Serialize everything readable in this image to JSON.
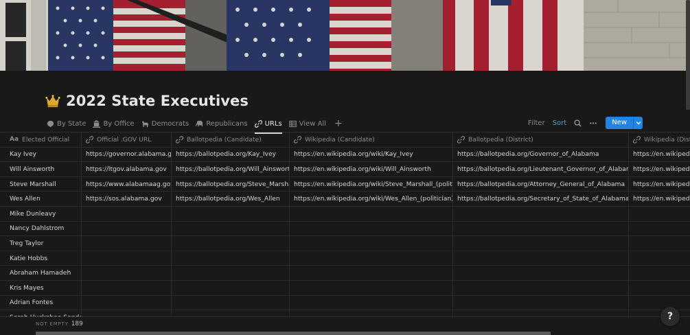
{
  "page": {
    "title": "2022 State Executives",
    "icon": "crown-icon"
  },
  "views": [
    {
      "label": "By State",
      "icon": "brain-icon"
    },
    {
      "label": "By Office",
      "icon": "building-icon"
    },
    {
      "label": "Democrats",
      "icon": "donkey-icon"
    },
    {
      "label": "Republicans",
      "icon": "elephant-icon"
    },
    {
      "label": "URLs",
      "icon": "link-icon",
      "active": true
    },
    {
      "label": "View All",
      "icon": "table-icon"
    }
  ],
  "toolbar": {
    "filter": "Filter",
    "sort": "Sort",
    "new": "New"
  },
  "columns": [
    {
      "label": "Elected Official",
      "icon": "Aa"
    },
    {
      "label": "Official .GOV URL",
      "icon": "link-icon"
    },
    {
      "label": "Ballotpedia (Candidate)",
      "icon": "link-icon"
    },
    {
      "label": "Wikipedia (Candidate)",
      "icon": "link-icon"
    },
    {
      "label": "Ballotpedia (District)",
      "icon": "link-icon"
    },
    {
      "label": "Wikipedia (Distr",
      "icon": "link-icon"
    }
  ],
  "rows": [
    [
      "Kay Ivey",
      "https://governor.alabama.gov/",
      "https://ballotpedia.org/Kay_Ivey",
      "https://en.wikipedia.org/wiki/Kay_Ivey",
      "https://ballotpedia.org/Governor_of_Alabama",
      "https://en.wikipedia"
    ],
    [
      "Will Ainsworth",
      "https://ltgov.alabama.gov",
      "https://ballotpedia.org/Will_Ainsworth",
      "https://en.wikipedia.org/wiki/Will_Ainsworth",
      "https://ballotpedia.org/Lieutenant_Governor_of_Alabama",
      "https://en.wikipedia"
    ],
    [
      "Steve Marshall",
      "https://www.alabamaag.gov",
      "https://ballotpedia.org/Steve_Marshall",
      "https://en.wikipedia.org/wiki/Steve_Marshall_(politician)",
      "https://ballotpedia.org/Attorney_General_of_Alabama",
      "https://en.wikipedia"
    ],
    [
      "Wes Allen",
      "https://sos.alabama.gov",
      "https://ballotpedia.org/Wes_Allen",
      "https://en.wikipedia.org/wiki/Wes_Allen_(politician)",
      "https://ballotpedia.org/Secretary_of_State_of_Alabama",
      "https://en.wikipedia"
    ],
    [
      "Mike Dunleavy",
      "",
      "",
      "",
      "",
      ""
    ],
    [
      "Nancy Dahlstrom",
      "",
      "",
      "",
      "",
      ""
    ],
    [
      "Treg Taylor",
      "",
      "",
      "",
      "",
      ""
    ],
    [
      "Katie Hobbs",
      "",
      "",
      "",
      "",
      ""
    ],
    [
      "Abraham Hamadeh",
      "",
      "",
      "",
      "",
      ""
    ],
    [
      "Kris Mayes",
      "",
      "",
      "",
      "",
      ""
    ],
    [
      "Adrian Fontes",
      "",
      "",
      "",
      "",
      ""
    ],
    [
      "Sarah Huckabee Sanders",
      "",
      "",
      "",
      "",
      ""
    ]
  ],
  "footer": {
    "calc_label": "NOT EMPTY",
    "calc_value": "189"
  },
  "help": "?"
}
